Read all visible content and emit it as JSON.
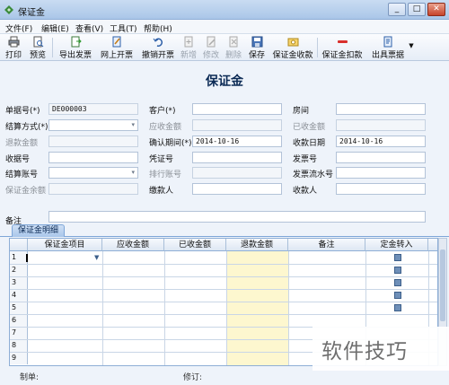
{
  "window": {
    "title": "保证金"
  },
  "window_buttons": {
    "minimize": "_",
    "maximize": "□",
    "close": "✕"
  },
  "menu": [
    "文件(F)",
    "编辑(E)",
    "查看(V)",
    "工具(T)",
    "帮助(H)"
  ],
  "toolbar": [
    {
      "label": "打印",
      "icon": "print-icon",
      "enabled": true
    },
    {
      "label": "预览",
      "icon": "preview-icon",
      "enabled": true
    },
    {
      "label": "导出发票",
      "icon": "export-invoice-icon",
      "enabled": true
    },
    {
      "label": "网上开票",
      "icon": "online-invoice-icon",
      "enabled": true
    },
    {
      "label": "撤销开票",
      "icon": "undo-invoice-icon",
      "enabled": true
    },
    {
      "label": "新增",
      "icon": "add-icon",
      "enabled": false
    },
    {
      "label": "修改",
      "icon": "edit-icon",
      "enabled": false
    },
    {
      "label": "删除",
      "icon": "delete-icon",
      "enabled": false
    },
    {
      "label": "保存",
      "icon": "save-icon",
      "enabled": true
    },
    {
      "label": "保证金收款",
      "icon": "deposit-receive-icon",
      "enabled": true
    },
    {
      "label": "保证金扣款",
      "icon": "deposit-deduct-icon",
      "enabled": true
    },
    {
      "label": "出具票据",
      "icon": "issue-receipt-icon",
      "enabled": true
    }
  ],
  "form": {
    "title": "保证金",
    "fields": {
      "doc_no": {
        "label": "单据号(*)",
        "value": "DE000003"
      },
      "customer": {
        "label": "客户(*)",
        "value": ""
      },
      "room": {
        "label": "房间",
        "value": ""
      },
      "settle_method": {
        "label": "结算方式(*)",
        "value": ""
      },
      "receivable": {
        "label": "应收金额",
        "value": ""
      },
      "received": {
        "label": "已收金额",
        "value": ""
      },
      "refund_amount": {
        "label": "退款金额",
        "value": ""
      },
      "confirm_period": {
        "label": "确认期间(*)",
        "value": "2014-10-16"
      },
      "receipt_date": {
        "label": "收款日期",
        "value": "2014-10-16"
      },
      "receipt_no": {
        "label": "收据号",
        "value": ""
      },
      "voucher_no": {
        "label": "凭证号",
        "value": ""
      },
      "invoice_no": {
        "label": "发票号",
        "value": ""
      },
      "settle_account": {
        "label": "结算账号",
        "value": ""
      },
      "bank_no": {
        "label": "排行账号",
        "value": ""
      },
      "invoice_serial": {
        "label": "发票流水号",
        "value": ""
      },
      "deposit_balance": {
        "label": "保证金余额",
        "value": ""
      },
      "payer": {
        "label": "缴款人",
        "value": ""
      },
      "payee": {
        "label": "收款人",
        "value": ""
      },
      "remark": {
        "label": "备注",
        "value": ""
      }
    }
  },
  "detail": {
    "tab_label": "保证金明细",
    "columns": [
      "保证金项目",
      "应收金额",
      "已收金额",
      "退款金额",
      "备注",
      "定金转入"
    ],
    "row_numbers": [
      "1",
      "2",
      "3",
      "4",
      "5",
      "6",
      "7",
      "8",
      "9"
    ]
  },
  "footer": {
    "maker_label": "制单:",
    "modifier_label": "修订:"
  },
  "watermark": {
    "text": "软件技巧"
  },
  "colors": {
    "title_blue": "#0b2a55",
    "refund_col": "#fdf7cf",
    "tab_blue": "#a8c6ea"
  }
}
